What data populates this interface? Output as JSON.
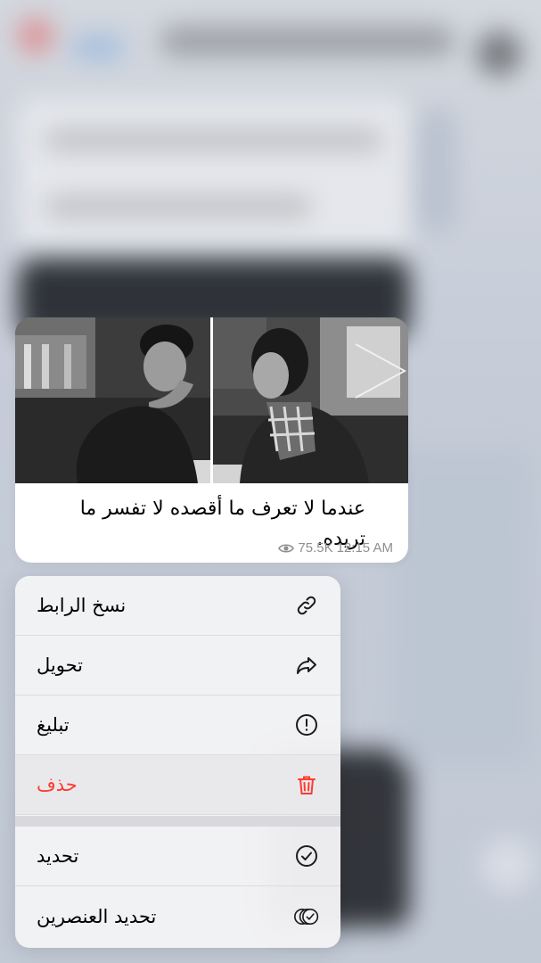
{
  "message": {
    "caption": "عندما لا تعرف ما أقصده لا تفسر ما تريده.",
    "views": "75.5K",
    "time": "12:15 AM"
  },
  "menu": {
    "items": [
      {
        "label": "نسخ الرابط",
        "icon": "link-icon"
      },
      {
        "label": "تحويل",
        "icon": "forward-icon"
      },
      {
        "label": "تبليغ",
        "icon": "report-icon"
      },
      {
        "label": "حذف",
        "icon": "trash-icon",
        "destructive": true
      },
      {
        "label": "تحديد",
        "icon": "checkmark-circle-icon"
      },
      {
        "label": "تحديد العنصرين",
        "icon": "double-check-circle-icon"
      }
    ]
  },
  "colors": {
    "destructive": "#ff3b30",
    "meta_text": "#8e8e93",
    "menu_bg": "#f3f3f5",
    "bubble_bg": "#ffffff"
  }
}
